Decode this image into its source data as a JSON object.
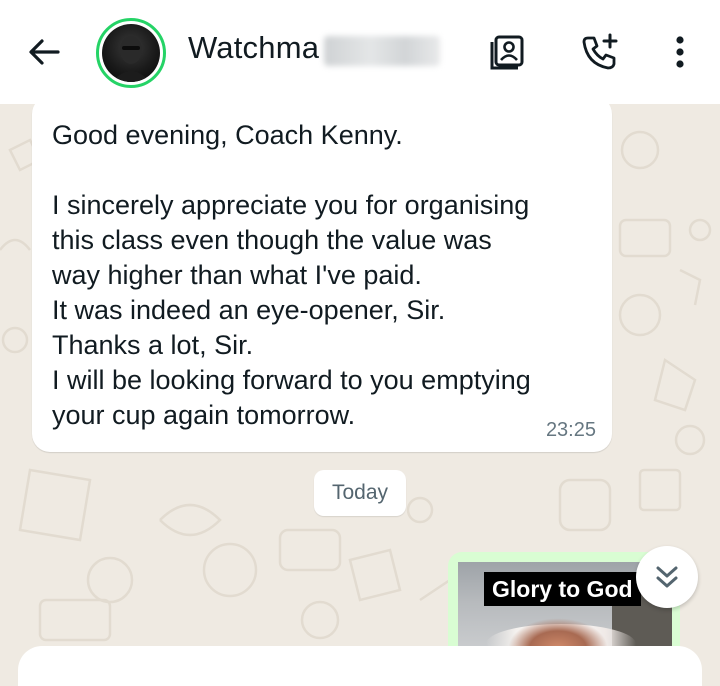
{
  "header": {
    "contact_name": "Watchma",
    "icons": [
      "back-arrow-icon",
      "contact-card-icon",
      "add-call-icon",
      "more-options-icon"
    ]
  },
  "messages": [
    {
      "direction": "incoming",
      "text": "Good evening, Coach Kenny.\n\nI sincerely appreciate you for organising\nthis class even though the value was\nway higher than what I've paid.\nIt was indeed an eye-opener, Sir.\nThanks a lot, Sir.\nI will be looking forward to you emptying\nyour cup again tomorrow.",
      "time": "23:25"
    }
  ],
  "date_divider": "Today",
  "outgoing_media": {
    "caption_overlay": "Glory to God"
  },
  "colors": {
    "accent_green": "#25d366",
    "wallpaper": "#efeae2",
    "incoming_bubble": "#ffffff",
    "outgoing_bubble": "#d9fdd3"
  }
}
